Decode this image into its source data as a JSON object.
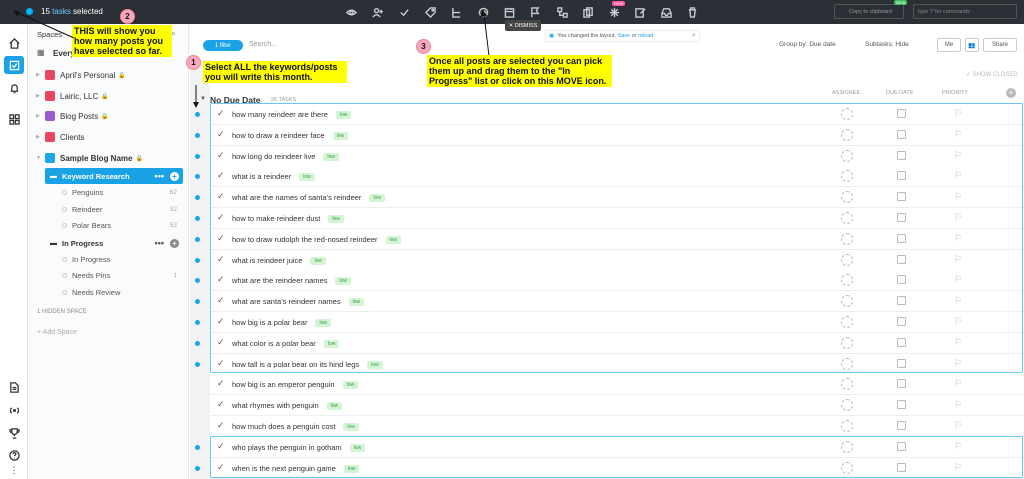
{
  "topbar": {
    "selected_count": "15",
    "selected_word": "tasks",
    "selected_suffix": "selected",
    "copy_label": "Copy to clipboard",
    "new_badge": "NEW",
    "cmd_placeholder": "type '/' for commands"
  },
  "sidebar": {
    "spaces_label": "Spaces",
    "everything_label": "Every",
    "items": [
      {
        "label": "April's Personal",
        "color": "#e94560"
      },
      {
        "label": "Lairic, LLC",
        "color": "#e94560"
      },
      {
        "label": "Blog Posts",
        "color": "#9b59d0"
      },
      {
        "label": "Clients",
        "color": "#e94560"
      },
      {
        "label": "Sample Blog Name",
        "color": "#1aa7e8"
      }
    ],
    "keyword_research": "Keyword Research",
    "kw_lists": [
      {
        "label": "Penguins",
        "count": "62"
      },
      {
        "label": "Reindeer",
        "count": "32"
      },
      {
        "label": "Polar Bears",
        "count": "53"
      }
    ],
    "in_progress": "In Progress",
    "ip_lists": [
      {
        "label": "In Progress",
        "count": ""
      },
      {
        "label": "Needs Pins",
        "count": "1"
      },
      {
        "label": "Needs Review",
        "count": ""
      }
    ],
    "hidden_space": "1 HIDDEN SPACE",
    "add_space": "+ Add Space"
  },
  "toolbar": {
    "filter": "1 filter",
    "search_placeholder": "Search...",
    "group_by": "Group by: Due date",
    "subtasks": "Subtasks: Hide",
    "me": "Me",
    "share": "Share",
    "show_closed": "✓ SHOW CLOSED",
    "dismiss": "✕ DISMISS",
    "layout_msg": "You changed the layout.",
    "save": "Save",
    "or": "or",
    "reload": "reload"
  },
  "group": {
    "title": "No Due Date",
    "count": "26 TASKS",
    "col_assignee": "ASSIGNEE",
    "col_due": "DUE DATE",
    "col_priority": "PRIORITY"
  },
  "tasks": [
    {
      "name": "how many reindeer are there",
      "tag": "low",
      "selected": true
    },
    {
      "name": "how to draw a reindeer face",
      "tag": "low",
      "selected": true
    },
    {
      "name": "how long do reindeer live",
      "tag": "low",
      "selected": true
    },
    {
      "name": "what is a reindeer",
      "tag": "low",
      "selected": true
    },
    {
      "name": "what are the names of santa's reindeer",
      "tag": "low",
      "selected": true
    },
    {
      "name": "how to make reindeer dust",
      "tag": "low",
      "selected": true
    },
    {
      "name": "how to draw rudolph the red-nosed reindeer",
      "tag": "low",
      "selected": true
    },
    {
      "name": "what is reindeer juice",
      "tag": "low",
      "selected": true
    },
    {
      "name": "what are the reindeer names",
      "tag": "low",
      "selected": true
    },
    {
      "name": "what are santa's reindeer names",
      "tag": "low",
      "selected": true
    },
    {
      "name": "how big is a polar bear",
      "tag": "low",
      "selected": true
    },
    {
      "name": "what color is a polar bear",
      "tag": "low",
      "selected": true
    },
    {
      "name": "how tall is a polar bear on its hind legs",
      "tag": "low",
      "selected": true
    },
    {
      "name": "how big is an emperor penguin",
      "tag": "low",
      "selected": false
    },
    {
      "name": "what rhymes with penguin",
      "tag": "low",
      "selected": false
    },
    {
      "name": "how much does a penguin cost",
      "tag": "low",
      "selected": false
    },
    {
      "name": "who plays the penguin in gotham",
      "tag": "low",
      "selected": true
    },
    {
      "name": "when is the next penguin game",
      "tag": "low",
      "selected": true
    }
  ],
  "annotations": {
    "n1": "1",
    "n1_text": "Select ALL the keywords/posts you will write this month.",
    "n2": "2",
    "n2_text": "THIS will show you how many posts you have selected so far.",
    "n3": "3",
    "n3_text": "Once all posts are selected you can pick them up and drag them to the \"In Progress\" list or click on this MOVE icon."
  },
  "colors": {
    "accent": "#19a3e6",
    "topbar": "#2b2f36",
    "note": "#ffff00"
  }
}
